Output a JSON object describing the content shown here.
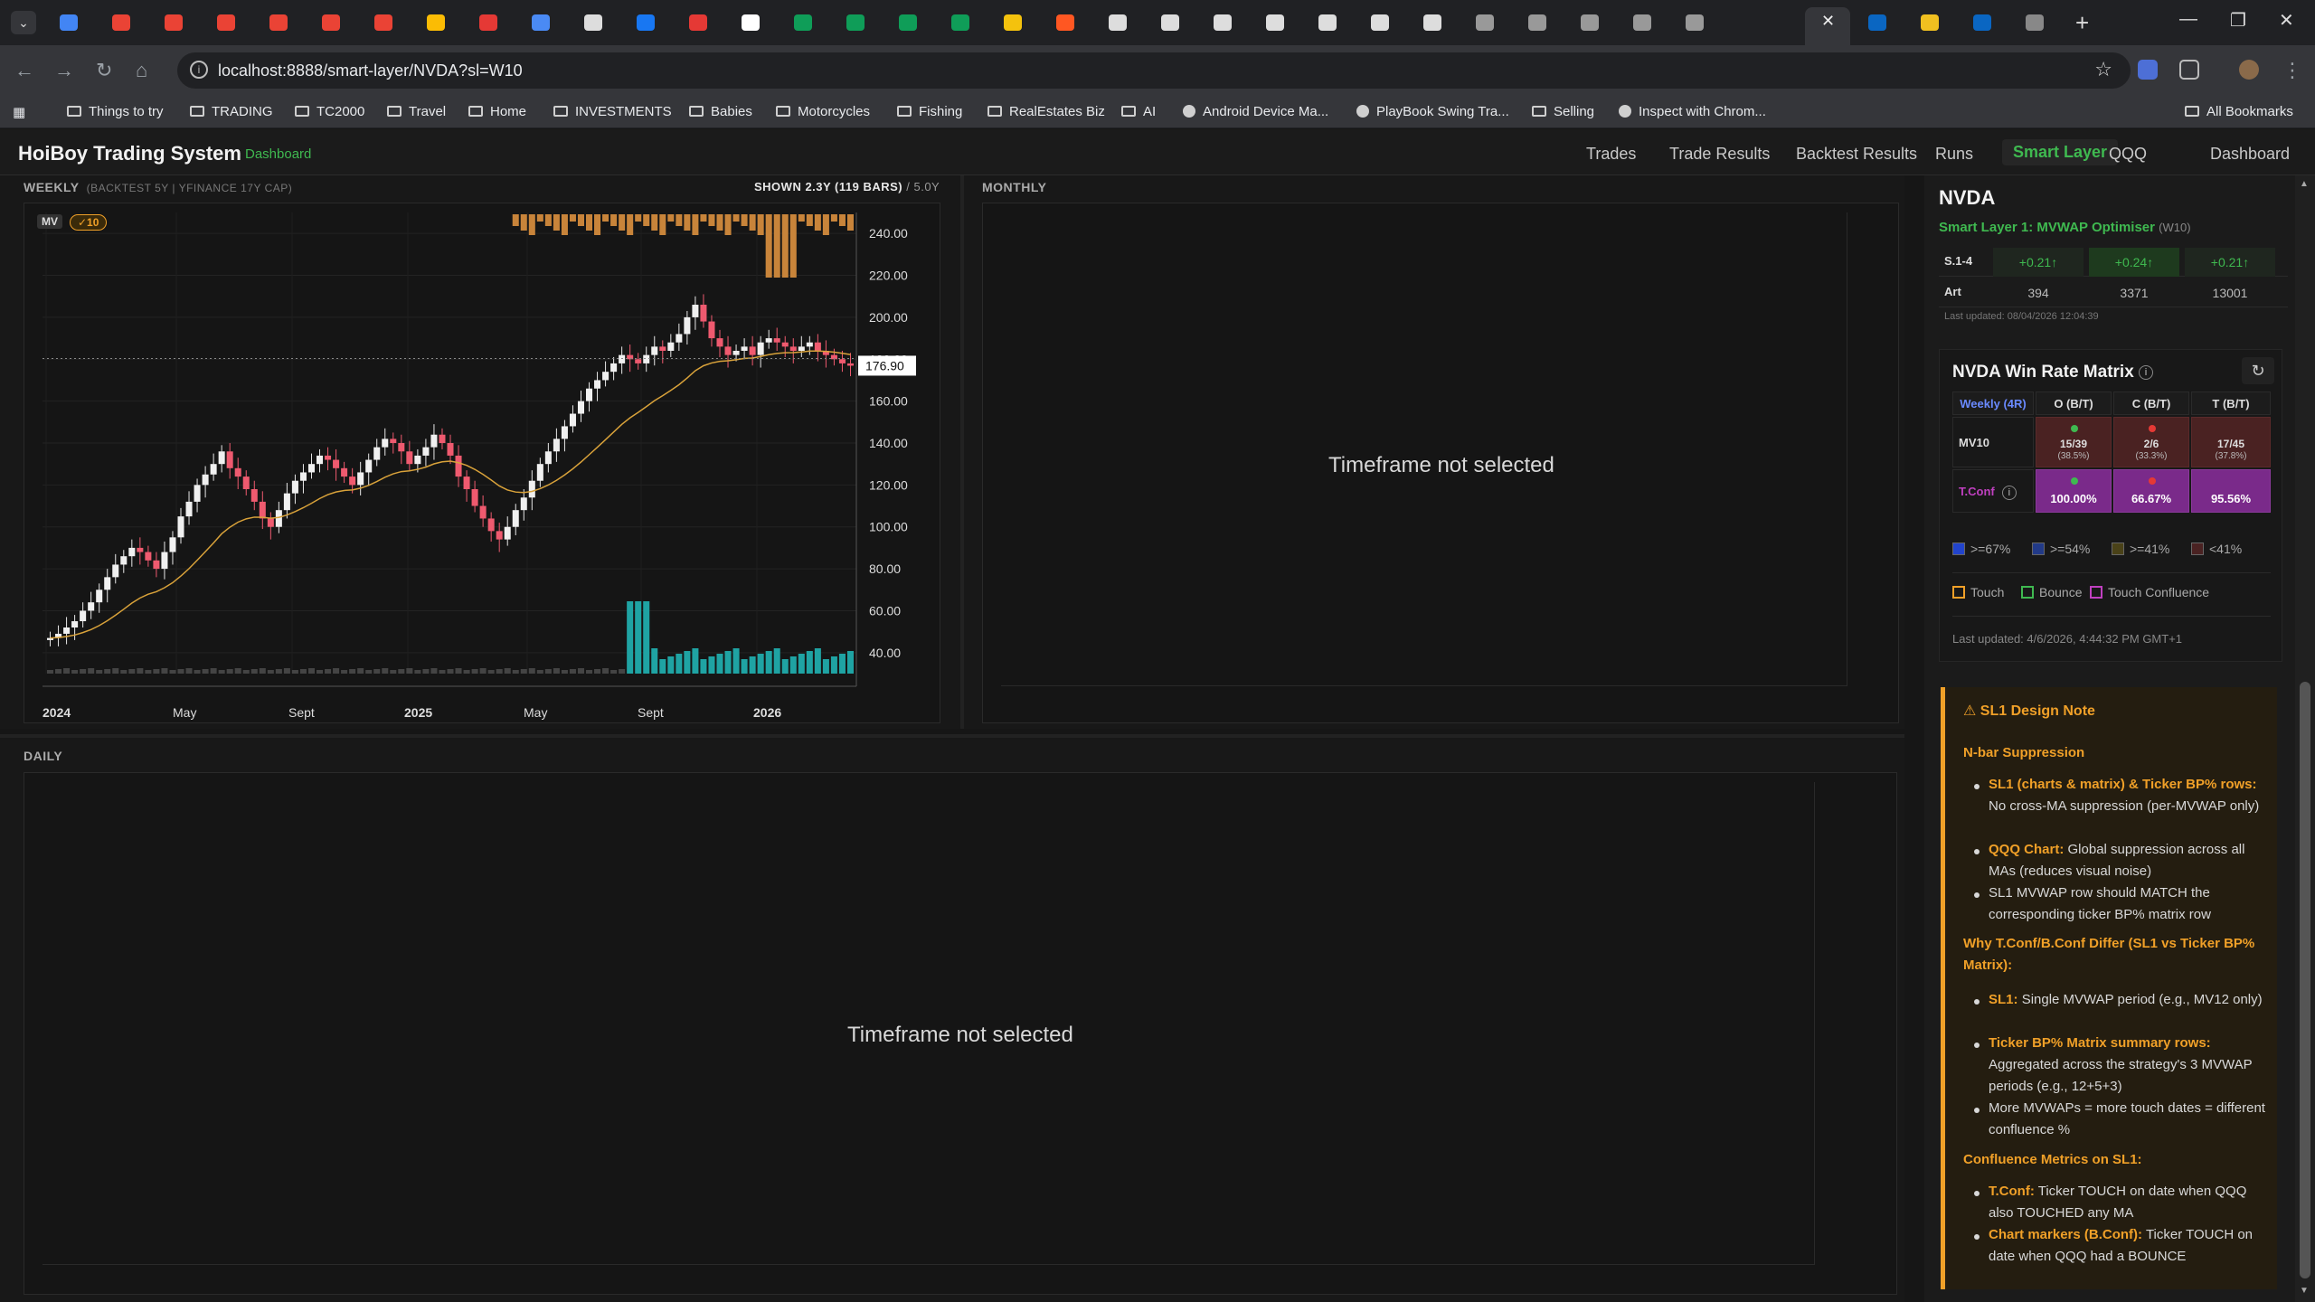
{
  "browser": {
    "url": "localhost:8888/smart-layer/NVDA?sl=W10",
    "bookmarks": [
      "Things to try",
      "TRADING",
      "TC2000",
      "Travel",
      "Home",
      "INVESTMENTS",
      "Babies",
      "Motorcycles",
      "Fishing",
      "RealEstates Biz",
      "AI",
      "Android Device Ma...",
      "PlayBook Swing Tra...",
      "Selling",
      "Inspect with Chrom..."
    ],
    "all_bookmarks": "All Bookmarks"
  },
  "app": {
    "brand": "HoiBoy Trading System",
    "brand_sub": "Dashboard",
    "nav": [
      "Trades",
      "Trade Results",
      "Backtest Results",
      "Runs",
      "Smart Layer",
      "QQQ",
      "Dashboard"
    ],
    "active_nav": "Smart Layer"
  },
  "weekly": {
    "title": "WEEKLY",
    "subtitle": "(BACKTEST 5Y | YFINANCE 17Y CAP)",
    "shown": "SHOWN 2.3Y (119 BARS)",
    "total": "/ 5.0Y",
    "badge_mv": "MV",
    "badge_10": "✓10",
    "last_price": "176.90"
  },
  "monthly": {
    "title": "MONTHLY",
    "placeholder": "Timeframe not selected"
  },
  "daily": {
    "title": "DAILY",
    "placeholder": "Timeframe not selected"
  },
  "chart_data": {
    "type": "candlestick",
    "title": "",
    "y_ticks": [
      "240.00",
      "220.00",
      "200.00",
      "180.00",
      "160.00",
      "140.00",
      "120.00",
      "100.00",
      "80.00",
      "60.00",
      "40.00"
    ],
    "x_ticks": [
      "2024",
      "May",
      "Sept",
      "2025",
      "May",
      "Sept",
      "2026"
    ],
    "ylim": [
      30,
      250
    ],
    "close_series": [
      47,
      49,
      52,
      55,
      60,
      64,
      70,
      76,
      82,
      86,
      90,
      88,
      84,
      80,
      88,
      95,
      105,
      112,
      120,
      125,
      130,
      136,
      128,
      124,
      118,
      112,
      104,
      100,
      108,
      116,
      122,
      126,
      130,
      134,
      132,
      128,
      124,
      120,
      126,
      132,
      138,
      142,
      140,
      136,
      130,
      134,
      138,
      144,
      140,
      134,
      124,
      118,
      110,
      104,
      98,
      94,
      100,
      108,
      114,
      122,
      130,
      136,
      142,
      148,
      154,
      160,
      166,
      170,
      174,
      178,
      182,
      180,
      178,
      182,
      186,
      184,
      188,
      192,
      200,
      206,
      198,
      190,
      186,
      182,
      184,
      186,
      182,
      188,
      190,
      188,
      186,
      184,
      186,
      188,
      184,
      182,
      180,
      178,
      176.9
    ],
    "last_price": 176.9
  },
  "sidebar": {
    "ticker": "NVDA",
    "layer_title": "Smart Layer 1: MVWAP Optimiser",
    "layer_code": "(W10)",
    "top_rows": [
      {
        "label": "S.1-4",
        "v1": "+0.21↑",
        "v2": "+0.24↑",
        "v3": "+0.21↑"
      },
      {
        "label": "Art",
        "v1": "394",
        "v2": "3371",
        "v3": "13001"
      }
    ],
    "top_updated": "Last updated: 08/04/2026 12:04:39",
    "matrix_title": "NVDA Win Rate Matrix",
    "matrix_headers": [
      "Weekly (4R)",
      "O (B/T)",
      "C (B/T)",
      "T (B/T)"
    ],
    "mv10": {
      "label": "MV10",
      "o": "15/39",
      "o_pct": "(38.5%)",
      "c": "2/6",
      "c_pct": "(33.3%)",
      "t": "17/45",
      "t_pct": "(37.8%)"
    },
    "tconf": {
      "label": "T.Conf",
      "o": "100.00%",
      "c": "66.67%",
      "t": "95.56%"
    },
    "legend_rates": [
      ">=67%",
      ">=54%",
      ">=41%",
      "<41%"
    ],
    "legend_rate_colors": [
      "#2244cc",
      "#223a88",
      "#4a4218",
      "#4a2222"
    ],
    "legend_types": [
      "Touch",
      "Bounce",
      "Touch Confluence"
    ],
    "legend_type_colors": [
      "#f0a028",
      "#3fb950",
      "#c040c0"
    ],
    "matrix_updated": "Last updated: 4/6/2026, 4:44:32 PM GMT+1"
  },
  "design_note": {
    "title": "SL1 Design Note",
    "h1": "N-bar Suppression",
    "b1_bold": "SL1 (charts & matrix) & Ticker BP% rows:",
    "b1_text": "No cross-MA suppression (per-MVWAP only)",
    "b2_bold": "QQQ Chart:",
    "b2_text": "Global suppression across all MAs (reduces visual noise)",
    "b3_text": "SL1 MVWAP row should MATCH the corresponding ticker BP% matrix row",
    "h2": "Why T.Conf/B.Conf Differ (SL1 vs Ticker BP% Matrix):",
    "b4_bold": "SL1:",
    "b4_text": "Single MVWAP period (e.g., MV12 only)",
    "b5_bold": "Ticker BP% Matrix summary rows:",
    "b5_text": "Aggregated across the strategy's 3 MVWAP periods (e.g., 12+5+3)",
    "b6_text": "More MVWAPs = more touch dates = different confluence %",
    "h3": "Confluence Metrics on SL1:",
    "b7_bold": "T.Conf:",
    "b7_text": "Ticker TOUCH on date when QQQ also TOUCHED any MA",
    "b8_bold": "Chart markers (B.Conf):",
    "b8_text": "Ticker TOUCH on date when QQQ had a BOUNCE"
  }
}
